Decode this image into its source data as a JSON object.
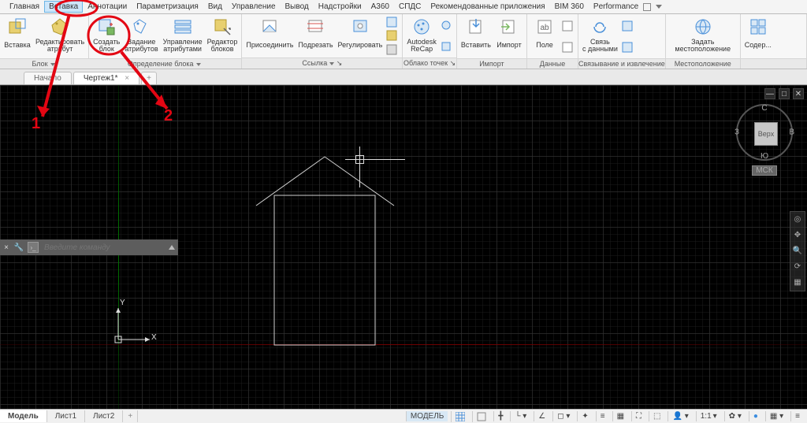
{
  "menu": {
    "items": [
      "Главная",
      "Вставка",
      "Аннотации",
      "Параметризация",
      "Вид",
      "Управление",
      "Вывод",
      "Надстройки",
      "A360",
      "СПДС",
      "Рекомендованные приложения",
      "BIM 360",
      "Performance"
    ],
    "active_index": 1
  },
  "ribbon": {
    "panels": [
      {
        "title": "Блок",
        "expand": true,
        "buttons": [
          {
            "name": "insert-btn",
            "label": "Вставка",
            "icon": "block"
          },
          {
            "name": "edit-attr-btn",
            "label": "Редактировать\nатрибут",
            "icon": "tag",
            "dd": true
          },
          {
            "name": "create-block-btn",
            "label": "Создать\nблок",
            "icon": "createblock"
          },
          {
            "name": "set-attrs-btn",
            "label": "Задание\nатрибутов",
            "icon": "tag2"
          },
          {
            "name": "manage-attrs-btn",
            "label": "Управление\nатрибутами",
            "icon": "manage"
          },
          {
            "name": "block-editor-btn",
            "label": "Редактор\nблоков",
            "icon": "editor"
          }
        ],
        "subpanel": {
          "from": 2,
          "title": "Определение блока",
          "expand": true
        }
      },
      {
        "title": "Ссылка",
        "expand": true,
        "arrow": true,
        "buttons": [
          {
            "name": "attach-btn",
            "label": "Присоединить",
            "icon": "attach"
          },
          {
            "name": "clip-btn",
            "label": "Подрезать",
            "icon": "clip"
          },
          {
            "name": "adjust-btn",
            "label": "Регулировать",
            "icon": "adjust"
          }
        ],
        "stack": [
          "s1",
          "s2",
          "s3"
        ]
      },
      {
        "title": "Облако точек",
        "arrow": true,
        "buttons": [
          {
            "name": "recap-btn",
            "label": "Autodesk\nReCap",
            "icon": "recap"
          }
        ],
        "stack": [
          "p1",
          "p2"
        ]
      },
      {
        "title": "Импорт",
        "buttons": [
          {
            "name": "insert2-btn",
            "label": "Вставить",
            "icon": "ins2"
          },
          {
            "name": "import-btn",
            "label": "Импорт",
            "icon": "import"
          }
        ]
      },
      {
        "title": "Данные",
        "buttons": [
          {
            "name": "field-btn",
            "label": "Поле",
            "icon": "field"
          }
        ],
        "stack": [
          "d1",
          "d2"
        ]
      },
      {
        "title": "Связывание и извлечение",
        "buttons": [
          {
            "name": "link-data-btn",
            "label": "Связь\nс данными",
            "icon": "link"
          }
        ],
        "stack": [
          "l1",
          "l2"
        ]
      },
      {
        "title": "Местоположение",
        "buttons": [
          {
            "name": "set-location-btn",
            "label": "Задать\nместоположение",
            "icon": "globe",
            "dd": true
          }
        ]
      },
      {
        "title": "",
        "buttons": [
          {
            "name": "content-btn",
            "label": "Содер...",
            "icon": "content"
          }
        ]
      }
    ]
  },
  "file_tabs": {
    "items": [
      {
        "name": "start-tab",
        "label": "Начало",
        "active": false
      },
      {
        "name": "drawing1-tab",
        "label": "Чертеж1*",
        "active": true
      }
    ],
    "add": "+"
  },
  "cmd": {
    "placeholder": "Введите команду",
    "close": "×"
  },
  "ucs": {
    "x": "X",
    "y": "Y"
  },
  "viewcube": {
    "face": "Верх",
    "n": "С",
    "s": "Ю",
    "e": "В",
    "w": "З",
    "mck": "МСК"
  },
  "canvas_controls": {
    "min": "—",
    "max": "□",
    "close": "✕"
  },
  "layout_tabs": {
    "items": [
      {
        "name": "model-tab",
        "label": "Модель",
        "active": true
      },
      {
        "name": "sheet1-tab",
        "label": "Лист1",
        "active": false
      },
      {
        "name": "sheet2-tab",
        "label": "Лист2",
        "active": false
      }
    ],
    "add": "+"
  },
  "status": {
    "model": "МОДЕЛЬ",
    "scale": "1:1",
    "items": [
      "grid",
      "snap",
      "+",
      "L",
      "angle",
      "snap2",
      "snap3",
      "target",
      "plane",
      "3d",
      "person",
      "scale",
      "gear",
      "dot",
      "dot2",
      "menu"
    ]
  },
  "annotation": {
    "label1": "1",
    "label2": "2"
  }
}
